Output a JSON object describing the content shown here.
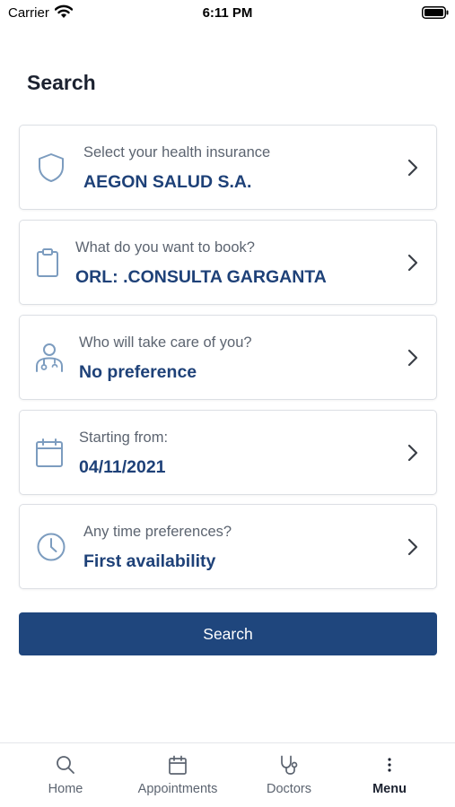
{
  "status_bar": {
    "carrier": "Carrier",
    "time": "6:11 PM"
  },
  "page": {
    "title": "Search"
  },
  "cards": [
    {
      "icon": "shield-icon",
      "label": "Select your health insurance",
      "value": "AEGON SALUD S.A."
    },
    {
      "icon": "clipboard-icon",
      "label": "What do you want to book?",
      "value": "ORL: .CONSULTA GARGANTA"
    },
    {
      "icon": "doctor-icon",
      "label": "Who will take care of you?",
      "value": "No preference"
    },
    {
      "icon": "calendar-icon",
      "label": "Starting from:",
      "value": "04/11/2021"
    },
    {
      "icon": "clock-icon",
      "label": "Any time preferences?",
      "value": "First availability"
    }
  ],
  "search_button": {
    "label": "Search"
  },
  "tab_bar": {
    "active": "Menu",
    "items": [
      {
        "icon": "search-icon",
        "label": "Home"
      },
      {
        "icon": "calendar-icon",
        "label": "Appointments"
      },
      {
        "icon": "stethoscope-icon",
        "label": "Doctors"
      },
      {
        "icon": "more-vertical-icon",
        "label": "Menu"
      }
    ]
  },
  "colors": {
    "accent": "#1f467d",
    "value_text": "#1e4178",
    "icon": "#7c9cbf",
    "label_text": "#5c6470",
    "border": "#dcdfe4"
  }
}
